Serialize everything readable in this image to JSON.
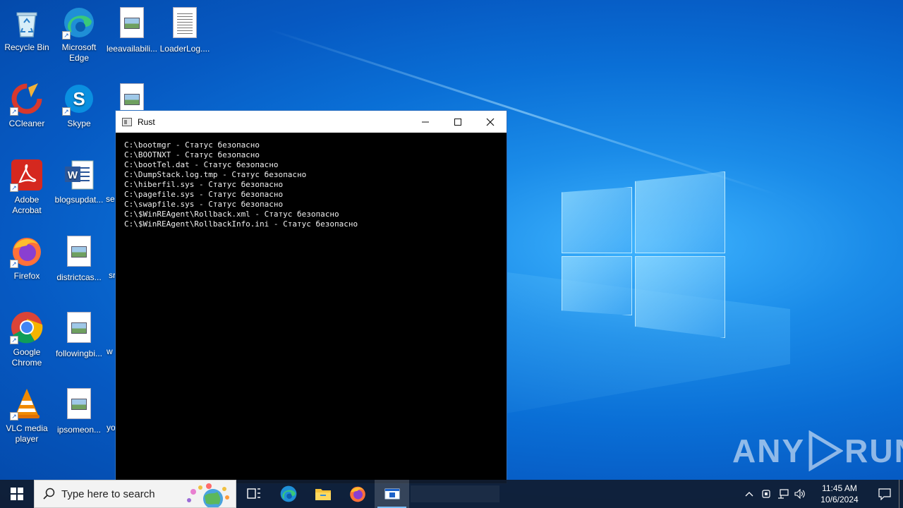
{
  "desktop": {
    "icons": [
      {
        "label": "Recycle Bin",
        "icon": "recycle-bin-icon"
      },
      {
        "label": "Microsoft Edge",
        "icon": "edge-icon"
      },
      {
        "label": "leeavailabili...",
        "icon": "image-file-icon"
      },
      {
        "label": "LoaderLog....",
        "icon": "text-file-icon"
      },
      {
        "label": "CCleaner",
        "icon": "ccleaner-icon"
      },
      {
        "label": "Skype",
        "icon": "skype-icon"
      },
      {
        "label": "Adobe Acrobat",
        "icon": "acrobat-icon"
      },
      {
        "label": "blogsupdat...",
        "icon": "word-file-icon"
      },
      {
        "label": "Firefox",
        "icon": "firefox-icon"
      },
      {
        "label": "districtcas...",
        "icon": "image-file-icon"
      },
      {
        "label": "Google Chrome",
        "icon": "chrome-icon"
      },
      {
        "label": "followingbi...",
        "icon": "image-file-icon"
      },
      {
        "label": "VLC media player",
        "icon": "vlc-icon"
      },
      {
        "label": "ipsomeon...",
        "icon": "image-file-icon"
      }
    ],
    "partial_labels": [
      "se",
      "sr",
      "w",
      "yo"
    ]
  },
  "console_window": {
    "title": "Rust",
    "controls": {
      "minimize": "–",
      "maximize": "☐",
      "close": "✕"
    },
    "lines": [
      "C:\\bootmgr - Статус безопасно",
      "C:\\BOOTNXT - Статус безопасно",
      "C:\\bootTel.dat - Статус безопасно",
      "C:\\DumpStack.log.tmp - Статус безопасно",
      "C:\\hiberfil.sys - Статус безопасно",
      "C:\\pagefile.sys - Статус безопасно",
      "C:\\swapfile.sys - Статус безопасно",
      "C:\\$WinREAgent\\Rollback.xml - Статус безопасно",
      "C:\\$WinREAgent\\RollbackInfo.ini - Статус безопасно"
    ]
  },
  "taskbar": {
    "search_placeholder": "Type here to search",
    "apps": [
      "task-view-icon",
      "edge-icon",
      "file-explorer-icon",
      "firefox-icon",
      "console-app-icon"
    ],
    "clock_time": "11:45 AM",
    "clock_date": "10/6/2024"
  },
  "watermark": {
    "left": "ANY",
    "right": "RUN"
  },
  "colors": {
    "console_bg": "#000000",
    "console_text": "#f0f0f0",
    "taskbar_bg": "#101c30",
    "accent": "#0a6fd6"
  }
}
